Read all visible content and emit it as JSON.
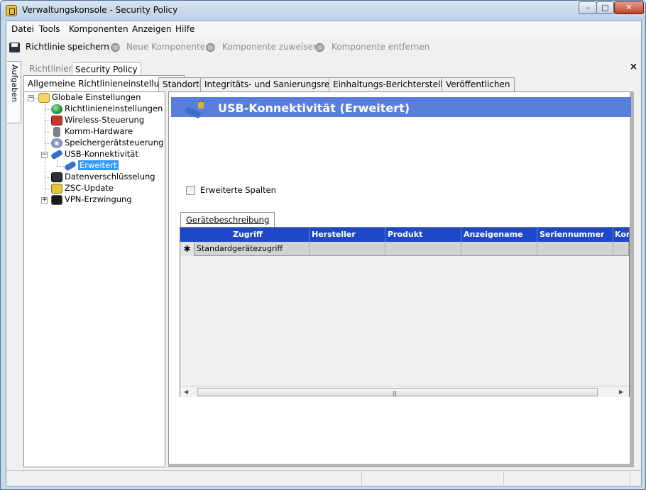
{
  "window": {
    "title": "Verwaltungskonsole - Security Policy",
    "min": "–",
    "max": "□",
    "close": "✕"
  },
  "menu": {
    "items": [
      "Datei",
      "Tools",
      "Komponenten",
      "Anzeigen",
      "Hilfe"
    ]
  },
  "toolbar": {
    "save": "Richtlinie speichern",
    "new_component": "Neue Komponente",
    "assign_component": "Komponente zuweisen",
    "remove_component": "Komponente entfernen"
  },
  "sidebar_tab": "Aufgaben",
  "doc_tabs": {
    "inactive": "Richtlinien",
    "active": "Security Policy",
    "close": "×"
  },
  "section_tabs": [
    "Allgemeine Richtlinieneinstellungen",
    "Standorte",
    "Integritäts- und Sanierungsregeln",
    "Einhaltungs-Berichterstellung",
    "Veröffentlichen"
  ],
  "tree": {
    "root": "Globale Einstellungen",
    "items": [
      "Richtlinieneinstellungen",
      "Wireless-Steuerung",
      "Komm-Hardware",
      "Speichergerätsteuerung",
      "USB-Konnektivität",
      "Datenverschlüsselung",
      "ZSC-Update",
      "VPN-Erzwingung"
    ],
    "usb_child": "Erweitert",
    "expanded": "−",
    "collapsed": "+"
  },
  "content": {
    "title": "USB-Konnektivität (Erweitert)",
    "checkbox_label": "Erweiterte Spalten",
    "grid_tab": "Gerätebeschreibung",
    "columns": [
      "Zugriff",
      "Hersteller",
      "Produkt",
      "Anzeigename",
      "Seriennummer",
      "Kor"
    ],
    "row_marker": "✱",
    "row_values": [
      "Standardgerätezugriff"
    ],
    "scroll_left": "◀",
    "scroll_right": "▶",
    "grip": "|||"
  },
  "colors": {
    "banner": "#5a7edc",
    "grid_header": "#1f48c9",
    "selection": "#3399ff"
  }
}
